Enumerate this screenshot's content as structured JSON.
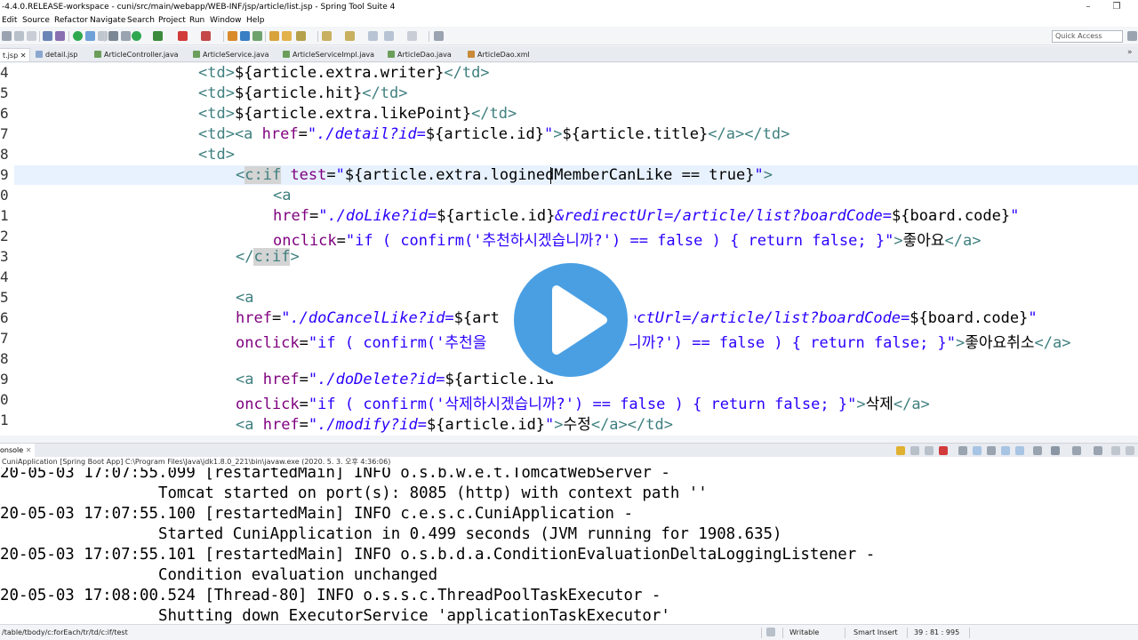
{
  "window": {
    "title": "-4.4.0.RELEASE-workspace - cuni/src/main/webapp/WEB-INF/jsp/article/list.jsp - Spring Tool Suite 4",
    "minimize": "–",
    "restore": "❐"
  },
  "menu": [
    "Edit",
    "Source",
    "Refactor",
    "Navigate",
    "Search",
    "Project",
    "Run",
    "Window",
    "Help"
  ],
  "quick_access": {
    "placeholder": "Quick Access"
  },
  "tabs": [
    {
      "label": "t.jsp",
      "close": "✕"
    },
    {
      "label": "detail.jsp"
    },
    {
      "label": "ArticleController.java"
    },
    {
      "label": "ArticleService.java"
    },
    {
      "label": "ArticleServiceImpl.java"
    },
    {
      "label": "ArticleDao.java"
    },
    {
      "label": "ArticleDao.xml"
    }
  ],
  "tab_overflow": "»",
  "editor": {
    "line_numbers": [
      "4",
      "5",
      "6",
      "7",
      "8",
      "9",
      "0",
      "1",
      "2",
      "3",
      "4",
      "5",
      "6",
      "7",
      "8",
      "9",
      "0",
      "1"
    ],
    "code": {
      "l4_open": "<td>",
      "l4_el": "${article.extra.writer}",
      "l4_close": "</td>",
      "l5_open": "<td>",
      "l5_el": "${article.hit}",
      "l5_close": "</td>",
      "l6_open": "<td>",
      "l6_el": "${article.extra.likePoint}",
      "l6_close": "</td>",
      "l7_open": "<td><a",
      "l7_attr": " href",
      "l7_eq": "=",
      "l7_val1": "\"./detail?id=",
      "l7_el1": "${article.id}",
      "l7_val2": "\"",
      "l7_gt": ">",
      "l7_el2": "${article.title}",
      "l7_close": "</a></td>",
      "l8_open": "<td>",
      "l9_lt": "<",
      "l9_tagname": "c:if",
      "l9_attr": " test",
      "l9_eq": "=",
      "l9_q1": "\"",
      "l9_el_a": "${article.extra.logine",
      "l9_el_b": "dMemberCanLike == true}",
      "l9_q2": "\"",
      "l9_gt": ">",
      "l10_open": "<a",
      "l11_attr": "href",
      "l11_eq": "=",
      "l11_val1": "\"./doLike?id=",
      "l11_el1": "${article.id}",
      "l11_val2": "&redirectUrl=/article/list?boardCode=",
      "l11_el2": "${board.code}",
      "l11_val3": "\"",
      "l12_attr": "onclick",
      "l12_eq": "=",
      "l12_val": "\"if ( confirm('추천하시겠습니까?') == false ) { return false; }\"",
      "l12_gt": ">",
      "l12_text": "좋아요",
      "l12_close": "</a>",
      "l13_lt": "</",
      "l13_tagname": "c:if",
      "l13_gt": ">",
      "l15_open": "<a",
      "l16_attr": "href",
      "l16_eq": "=",
      "l16_val1": "\"./doCancelLike?id=",
      "l16_el1": "${art",
      "l16_val2": "ectUrl=/article/list?boardCode=",
      "l16_el2": "${board.code}",
      "l16_val3": "\"",
      "l17_attr": "onclick",
      "l17_eq": "=",
      "l17_val1": "\"if ( confirm('추천을",
      "l17_val2": "니까?') == false ) { return false; }\"",
      "l17_gt": ">",
      "l17_text": "좋아요취소",
      "l17_close": "</a>",
      "l19_open": "<a",
      "l19_attr": " href",
      "l19_eq": "=",
      "l19_val": "\"./doDelete?id=",
      "l19_el": "${article.id",
      "l20_attr": "onclick",
      "l20_eq": "=",
      "l20_val": "\"if ( confirm('삭제하시겠습니까?') == false ) { return false; }\"",
      "l20_gt": ">",
      "l20_text": "삭제",
      "l20_close": "</a>",
      "l21_open": "<a",
      "l21_attr": " href",
      "l21_eq": "=",
      "l21_val1": "\"./modify?id=",
      "l21_el": "${article.id}",
      "l21_val2": "\"",
      "l21_gt": ">",
      "l21_text": "수정",
      "l21_close": "</a></td>"
    }
  },
  "console": {
    "tab_label": "onsole",
    "tab_close": "✕",
    "process": "CuniApplication [Spring Boot App] C:\\Program Files\\Java\\jdk1.8.0_221\\bin\\javaw.exe (2020. 5. 3. 오후 4:36:06)",
    "lines": [
      "20-05-03 17:07:55.099 [restartedMain] INFO o.s.b.w.e.t.TomcatWebServer -",
      "                 Tomcat started on port(s): 8085 (http) with context path ''",
      "20-05-03 17:07:55.100 [restartedMain] INFO c.e.s.c.CuniApplication -",
      "                 Started CuniApplication in 0.499 seconds (JVM running for 1908.635)",
      "20-05-03 17:07:55.101 [restartedMain] INFO o.s.b.d.a.ConditionEvaluationDeltaLoggingListener -",
      "                 Condition evaluation unchanged",
      "20-05-03 17:08:00.524 [Thread-80] INFO o.s.s.c.ThreadPoolTaskExecutor -",
      "                 Shutting down ExecutorService 'applicationTaskExecutor'"
    ]
  },
  "status": {
    "path": "/table/tbody/c:forEach/tr/td/c:if/test",
    "writable": "Writable",
    "insert_mode": "Smart Insert",
    "position": "39 : 81 : 995"
  },
  "colors": {
    "tag": "#3f7f7f",
    "attribute": "#7f007f",
    "string": "#2a00ff",
    "current_line": "#e8f2fe",
    "play_button": "#4a9fe3"
  }
}
